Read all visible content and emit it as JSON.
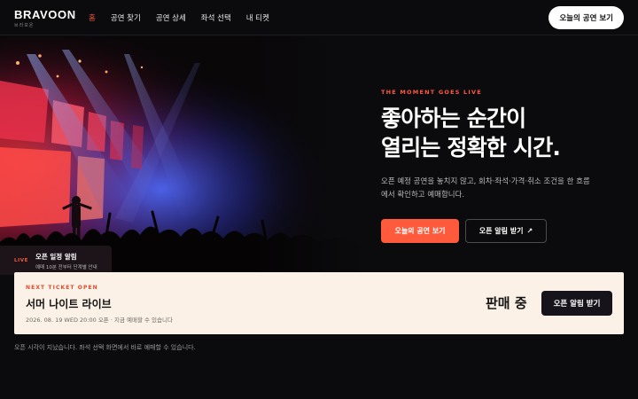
{
  "brand": {
    "name": "BRAVOON",
    "tagline": "브라보온"
  },
  "nav": {
    "items": [
      {
        "label": "홈",
        "active": true
      },
      {
        "label": "공연 찾기",
        "active": false
      },
      {
        "label": "공연 상세",
        "active": false
      },
      {
        "label": "좌석 선택",
        "active": false
      },
      {
        "label": "내 티켓",
        "active": false
      }
    ],
    "cta_label": "오늘의 공연 보기"
  },
  "hero": {
    "eyebrow": "THE MOMENT GOES LIVE",
    "headline_line1": "좋아하는 순간이",
    "headline_line2": "열리는 정확한 시간.",
    "description": "오픈 예정 공연을 놓치지 않고, 회차·좌석·가격·취소 조건을 한 흐름에서 확인하고 예매합니다.",
    "primary_button": "오늘의 공연 보기",
    "secondary_button": "오픈 알림 받기",
    "secondary_icon": "arrow-up-right-icon"
  },
  "live_card": {
    "tag": "LIVE",
    "title": "오픈 일정 알림",
    "subtitle": "예매 10분 전부터 단계별 안내"
  },
  "ticket": {
    "eyebrow": "NEXT TICKET OPEN",
    "title": "서머 나이트 라이브",
    "meta": "2026. 08. 19 WED 20:00 오픈 · 지금 예매할 수 있습니다",
    "status": "판매 중",
    "button": "오픈 알림 받기"
  },
  "footer_note": "오픈 시각이 지났습니다. 좌석 선택 화면에서 바로 예매할 수 있습니다.",
  "colors": {
    "accent": "#ff5a3c",
    "background": "#0b0b0d",
    "panel": "#fbf1e6",
    "dark_button": "#17131b"
  }
}
